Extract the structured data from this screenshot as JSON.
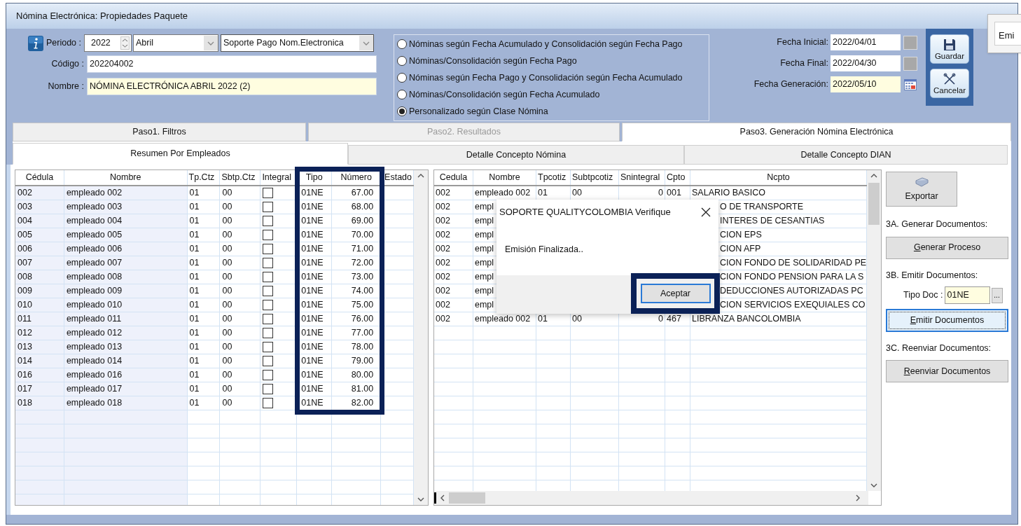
{
  "window": {
    "title": "Nómina Electrónica: Propiedades Paquete"
  },
  "background_window": {
    "button_label": "Emi"
  },
  "form": {
    "periodo_label": "Periodo :",
    "year": "2022",
    "month": "Abril",
    "type": "Soporte Pago Nom.Electronica",
    "codigo_label": "Código :",
    "codigo": "202204002",
    "nombre_label": "Nombre :",
    "nombre": "NÓMINA ELECTRÓNICA ABRIL 2022 (2)"
  },
  "radio_options": [
    {
      "label": "Nóminas según Fecha Acumulado y Consolidación según Fecha Pago",
      "selected": false
    },
    {
      "label": "Nóminas/Consolidación según Fecha Pago",
      "selected": false
    },
    {
      "label": "Nóminas según Fecha Pago y Consolidación según Fecha Acumulado",
      "selected": false
    },
    {
      "label": "Nóminas/Consolidación según Fecha Acumulado",
      "selected": false
    },
    {
      "label": "Personalizado según Clase Nómina",
      "selected": true
    }
  ],
  "dates": [
    {
      "label": "Fecha Inicial:",
      "value": "2022/04/01",
      "kind": "plain"
    },
    {
      "label": "Fecha Final:",
      "value": "2022/04/30",
      "kind": "plain"
    },
    {
      "label": "Fecha Generación:",
      "value": "2022/05/10",
      "kind": "calendar"
    }
  ],
  "action_buttons": [
    {
      "label": "Guardar",
      "kind": "save"
    },
    {
      "label": "Cancelar",
      "kind": "cancel"
    }
  ],
  "step_tabs": [
    {
      "label": "Paso1. Filtros",
      "selected": false,
      "disabled": false
    },
    {
      "label": "Paso2. Resultados",
      "selected": false,
      "disabled": true
    },
    {
      "label": "Paso3. Generación Nómina Electrónica",
      "selected": true,
      "disabled": false
    }
  ],
  "sub_tabs": [
    {
      "label": "Resumen Por Empleados",
      "selected": true
    },
    {
      "label": "Detalle Concepto Nómina",
      "selected": false
    },
    {
      "label": "Detalle Concepto DIAN",
      "selected": false
    }
  ],
  "employees_table": {
    "columns": [
      "Cédula",
      "Nombre",
      "Tp.Ctz",
      "Sbtp.Ctz",
      "Integral",
      "Tipo",
      "Número",
      "Estado"
    ],
    "rows": [
      {
        "cedula": "002",
        "nombre": "empleado 002",
        "tp_ctz": "01",
        "sbtp_ctz": "00",
        "integral": false,
        "tipo": "01NE",
        "numero": "67.00"
      },
      {
        "cedula": "003",
        "nombre": "empleado 003",
        "tp_ctz": "01",
        "sbtp_ctz": "00",
        "integral": false,
        "tipo": "01NE",
        "numero": "68.00"
      },
      {
        "cedula": "004",
        "nombre": "empleado 004",
        "tp_ctz": "01",
        "sbtp_ctz": "00",
        "integral": false,
        "tipo": "01NE",
        "numero": "69.00"
      },
      {
        "cedula": "005",
        "nombre": "empleado 005",
        "tp_ctz": "01",
        "sbtp_ctz": "00",
        "integral": false,
        "tipo": "01NE",
        "numero": "70.00"
      },
      {
        "cedula": "006",
        "nombre": "empleado 006",
        "tp_ctz": "01",
        "sbtp_ctz": "00",
        "integral": false,
        "tipo": "01NE",
        "numero": "71.00"
      },
      {
        "cedula": "007",
        "nombre": "empleado 007",
        "tp_ctz": "01",
        "sbtp_ctz": "00",
        "integral": false,
        "tipo": "01NE",
        "numero": "72.00"
      },
      {
        "cedula": "008",
        "nombre": "empleado 008",
        "tp_ctz": "01",
        "sbtp_ctz": "00",
        "integral": false,
        "tipo": "01NE",
        "numero": "73.00"
      },
      {
        "cedula": "009",
        "nombre": "empleado 009",
        "tp_ctz": "01",
        "sbtp_ctz": "00",
        "integral": false,
        "tipo": "01NE",
        "numero": "74.00"
      },
      {
        "cedula": "010",
        "nombre": "empleado 010",
        "tp_ctz": "01",
        "sbtp_ctz": "00",
        "integral": false,
        "tipo": "01NE",
        "numero": "75.00"
      },
      {
        "cedula": "011",
        "nombre": "empleado 011",
        "tp_ctz": "01",
        "sbtp_ctz": "00",
        "integral": false,
        "tipo": "01NE",
        "numero": "76.00"
      },
      {
        "cedula": "012",
        "nombre": "empleado 012",
        "tp_ctz": "01",
        "sbtp_ctz": "00",
        "integral": false,
        "tipo": "01NE",
        "numero": "77.00"
      },
      {
        "cedula": "013",
        "nombre": "empleado 013",
        "tp_ctz": "01",
        "sbtp_ctz": "00",
        "integral": false,
        "tipo": "01NE",
        "numero": "78.00"
      },
      {
        "cedula": "014",
        "nombre": "empleado 014",
        "tp_ctz": "01",
        "sbtp_ctz": "00",
        "integral": false,
        "tipo": "01NE",
        "numero": "79.00"
      },
      {
        "cedula": "016",
        "nombre": "empleado 016",
        "tp_ctz": "01",
        "sbtp_ctz": "00",
        "integral": false,
        "tipo": "01NE",
        "numero": "80.00"
      },
      {
        "cedula": "017",
        "nombre": "empleado 017",
        "tp_ctz": "01",
        "sbtp_ctz": "00",
        "integral": false,
        "tipo": "01NE",
        "numero": "81.00"
      },
      {
        "cedula": "018",
        "nombre": "empleado 018",
        "tp_ctz": "01",
        "sbtp_ctz": "00",
        "integral": false,
        "tipo": "01NE",
        "numero": "82.00"
      }
    ]
  },
  "concepts_table": {
    "columns": [
      "Cedula",
      "Nombre",
      "Tpcotiz",
      "Subtpcotiz",
      "Snintegral",
      "Cpto",
      "Ncpto"
    ],
    "rows": [
      {
        "covered": false,
        "cedula": "002",
        "nombre": "empleado 002",
        "tpcotiz": "01",
        "subtpcotiz": "00",
        "snintegral": "0",
        "cpto": "001",
        "ncpto": "SALARIO BASICO"
      },
      {
        "covered": true,
        "cedula": "002",
        "nombre": "empl",
        "ncpto": "O DE TRANSPORTE"
      },
      {
        "covered": true,
        "cedula": "002",
        "nombre": "empl",
        "ncpto": "INTERES DE CESANTIAS"
      },
      {
        "covered": true,
        "cedula": "002",
        "nombre": "empl",
        "ncpto": "CION EPS"
      },
      {
        "covered": true,
        "cedula": "002",
        "nombre": "empl",
        "ncpto": "CION AFP"
      },
      {
        "covered": true,
        "cedula": "002",
        "nombre": "empl",
        "ncpto": "CION FONDO DE SOLIDARIDAD PE"
      },
      {
        "covered": true,
        "cedula": "002",
        "nombre": "empl",
        "ncpto": "CION FONDO PENSION PARA LA S"
      },
      {
        "covered": true,
        "cedula": "002",
        "nombre": "empl",
        "ncpto": "DEDUCCIONES AUTORIZADAS PC"
      },
      {
        "covered": true,
        "cedula": "002",
        "nombre": "empl",
        "ncpto": "CION SERVICIOS EXEQUIALES CO"
      },
      {
        "covered": false,
        "cedula": "002",
        "nombre": "empleado 002",
        "tpcotiz": "01",
        "subtpcotiz": "00",
        "snintegral": "0",
        "cpto": "467",
        "ncpto": "LIBRANZA BANCOLOMBIA"
      }
    ]
  },
  "side_panel": {
    "export_button": "Exportar",
    "generate_heading": "3A. Generar Documentos:",
    "generate_button": "Generar Proceso",
    "emit_heading": "3B. Emitir Documentos:",
    "tipo_doc_label": "Tipo Doc :",
    "tipo_doc_value": "01NE",
    "browse_button": "...",
    "emit_button": "Emitir Documentos",
    "resend_heading": "3C. Reenviar Documentos:",
    "resend_button": "Reenviar Documentos"
  },
  "dialog": {
    "title": "SOPORTE QUALITYCOLOMBIA Verifique",
    "message": "Emisión Finalizada..",
    "button": "Aceptar"
  }
}
